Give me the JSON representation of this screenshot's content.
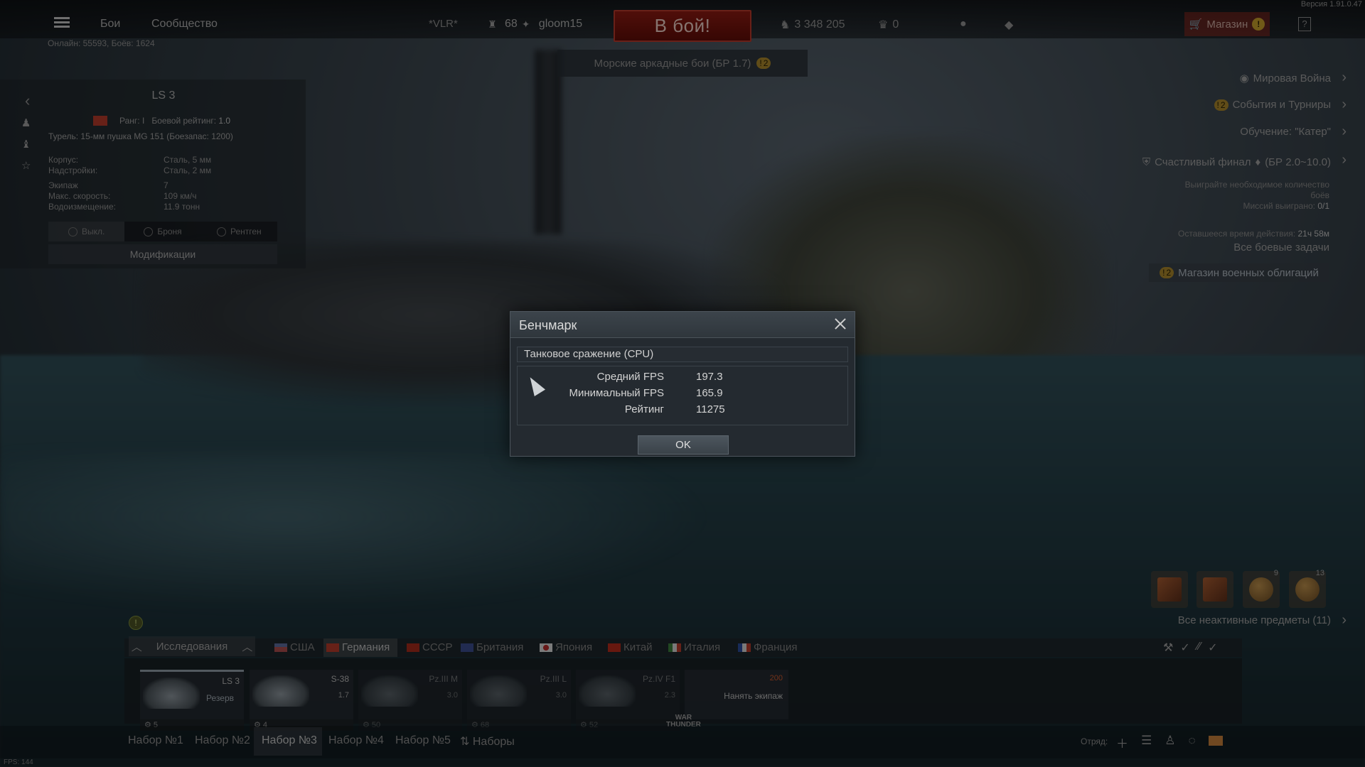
{
  "version": "Версия 1.91.0.47",
  "topbar": {
    "battles": "Бои",
    "community": "Сообщество",
    "clan_tag": "*VLR*",
    "player_level": "68",
    "player_name": "gloom15",
    "battle_button": "В бой!",
    "silver_lions": "3 348 205",
    "golden_eagles": "0",
    "shop": "Магазин",
    "shop_badge": "!",
    "help": "?"
  },
  "online": "Онлайн: 55593, Боёв: 1624",
  "game_mode": {
    "label": "Морские аркадные бои (БР 1.7)",
    "badge": "2"
  },
  "vehicle": {
    "name": "LS 3",
    "rank": "Ранг: I",
    "battle_rating_label": "Боевой рейтинг:",
    "battle_rating": "1.0",
    "turret": "Турель: 15-мм пушка MG 151 (Боезапас: 1200)",
    "specs": [
      {
        "key": "Корпус:",
        "value": "Сталь, 5 мм"
      },
      {
        "key": "Надстройки:",
        "value": "Сталь, 2 мм"
      },
      {
        "key": "Экипаж",
        "value": "7"
      },
      {
        "key": "Макс. скорость:",
        "value": "109 км/ч"
      },
      {
        "key": "Водоизмещение:",
        "value": "11.9 тонн"
      }
    ],
    "armor_tabs": [
      "Выкл.",
      "Броня",
      "Рентген"
    ],
    "modifications": "Модификации"
  },
  "right_panel": {
    "world_war": "Мировая Война",
    "events_badge": "2",
    "events": "События и Турниры",
    "tutorial": "Обучение: \"Катер\"",
    "happy_end_title": "Счастливый финал",
    "happy_end_br": "(БР 2.0~10.0)",
    "happy_end_desc_1": "Выиграйте необходимое количество",
    "happy_end_desc_2": "боёв",
    "missions_won_label": "Миссий выиграно:",
    "missions_won": "0/1",
    "time_left_label": "Оставшееся время действия:",
    "time_left": "21ч 58м",
    "all_tasks": "Все боевые задачи",
    "bonds_badge": "2",
    "bonds_shop": "Магазин военных облигаций"
  },
  "items": {
    "counts": [
      "",
      "",
      "9",
      "13"
    ],
    "inactive": "Все неактивные предметы (11)"
  },
  "nations": {
    "research": "Исследования",
    "list": [
      "США",
      "Германия",
      "СССР",
      "Британия",
      "Япония",
      "Китай",
      "Италия",
      "Франция"
    ],
    "active": "Германия"
  },
  "slots": [
    {
      "name": "LS 3",
      "status": "Резерв",
      "br": "",
      "crew": "5"
    },
    {
      "name": "S-38",
      "status": "",
      "br": "1.7",
      "crew": "4"
    },
    {
      "name": "Pz.III M",
      "status": "",
      "br": "3.0",
      "crew": "50"
    },
    {
      "name": "Pz.III L",
      "status": "",
      "br": "3.0",
      "crew": "68"
    },
    {
      "name": "Pz.IV F1",
      "status": "",
      "br": "2.3",
      "crew": "52"
    }
  ],
  "crew_slot": {
    "cost": "200",
    "label": "Нанять экипаж"
  },
  "logo": {
    "line1": "WAR",
    "line2": "THUNDER"
  },
  "presets": [
    "Набор №1",
    "Набор №2",
    "Набор №3",
    "Набор №4",
    "Набор №5",
    "Наборы"
  ],
  "squad_label": "Отряд:",
  "fps": "FPS: 144",
  "dialog": {
    "title": "Бенчмарк",
    "subtitle": "Танковое сражение (CPU)",
    "avg_fps_label": "Средний FPS",
    "avg_fps": "197.3",
    "min_fps_label": "Минимальный FPS",
    "min_fps": "165.9",
    "rating_label": "Рейтинг",
    "rating": "11275",
    "ok": "OK"
  }
}
